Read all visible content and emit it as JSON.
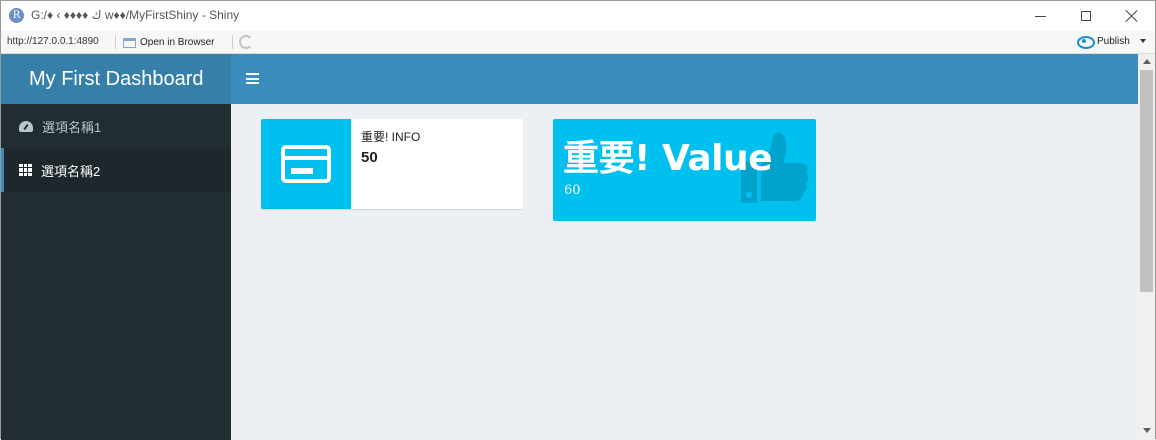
{
  "window": {
    "app_icon_letter": "R",
    "title": "G:/♦ ‹ ♦♦♦♦ ﻙ w♦♦/MyFirstShiny - Shiny"
  },
  "viewer": {
    "url": "http://127.0.0.1:4890",
    "open_in_browser": "Open in Browser",
    "publish": "Publish"
  },
  "header": {
    "logo": "My First Dashboard"
  },
  "sidebar": {
    "items": [
      {
        "label": "選項名稱1",
        "icon": "dashboard-icon",
        "active": false
      },
      {
        "label": "選項名稱2",
        "icon": "th-grid-icon",
        "active": true
      }
    ]
  },
  "info_box": {
    "title": "重要! INFO",
    "value": "50",
    "icon": "credit-card-icon",
    "color": "#00c0ef"
  },
  "value_box": {
    "title": "重要! Value",
    "subtitle": "60",
    "icon": "thumbs-up-icon",
    "color": "#00c0ef"
  },
  "colors": {
    "header": "#3c8dbc",
    "logo_bg": "#367fa9",
    "sidebar_bg": "#222d32",
    "content_bg": "#ecf0f5"
  }
}
